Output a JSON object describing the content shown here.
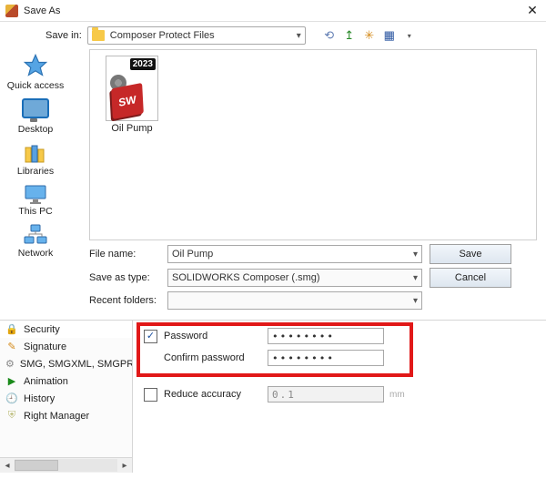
{
  "title": "Save As",
  "save_in": {
    "label": "Save in:",
    "folder_name": "Composer Protect Files"
  },
  "nav_icons": {
    "back": "⟲",
    "up": "↥",
    "new_folder": "✳",
    "views": "▦"
  },
  "places": {
    "quick_access": "Quick access",
    "desktop": "Desktop",
    "libraries": "Libraries",
    "this_pc": "This PC",
    "network": "Network"
  },
  "file_item": {
    "year": "2023",
    "sw": "SW",
    "caption": "Oil Pump"
  },
  "fields": {
    "file_name_label": "File name:",
    "file_name_value": "Oil Pump",
    "save_as_type_label": "Save as type:",
    "save_as_type_value": "SOLIDWORKS Composer (.smg)",
    "recent_label": "Recent folders:",
    "recent_value": ""
  },
  "buttons": {
    "save": "Save",
    "cancel": "Cancel"
  },
  "tabs": [
    {
      "icon": "lock",
      "label": "Security"
    },
    {
      "icon": "pen",
      "label": "Signature"
    },
    {
      "icon": "gear",
      "label": "SMG, SMGXML, SMGPROJ Options"
    },
    {
      "icon": "play",
      "label": "Animation"
    },
    {
      "icon": "clock",
      "label": "History"
    },
    {
      "icon": "shield",
      "label": "Right Manager"
    }
  ],
  "security_panel": {
    "password_label": "Password",
    "password_value": "••••••••",
    "confirm_label": "Confirm password",
    "confirm_value": "••••••••",
    "reduce_label": "Reduce accuracy",
    "reduce_value": "0.1",
    "reduce_unit": "mm"
  }
}
